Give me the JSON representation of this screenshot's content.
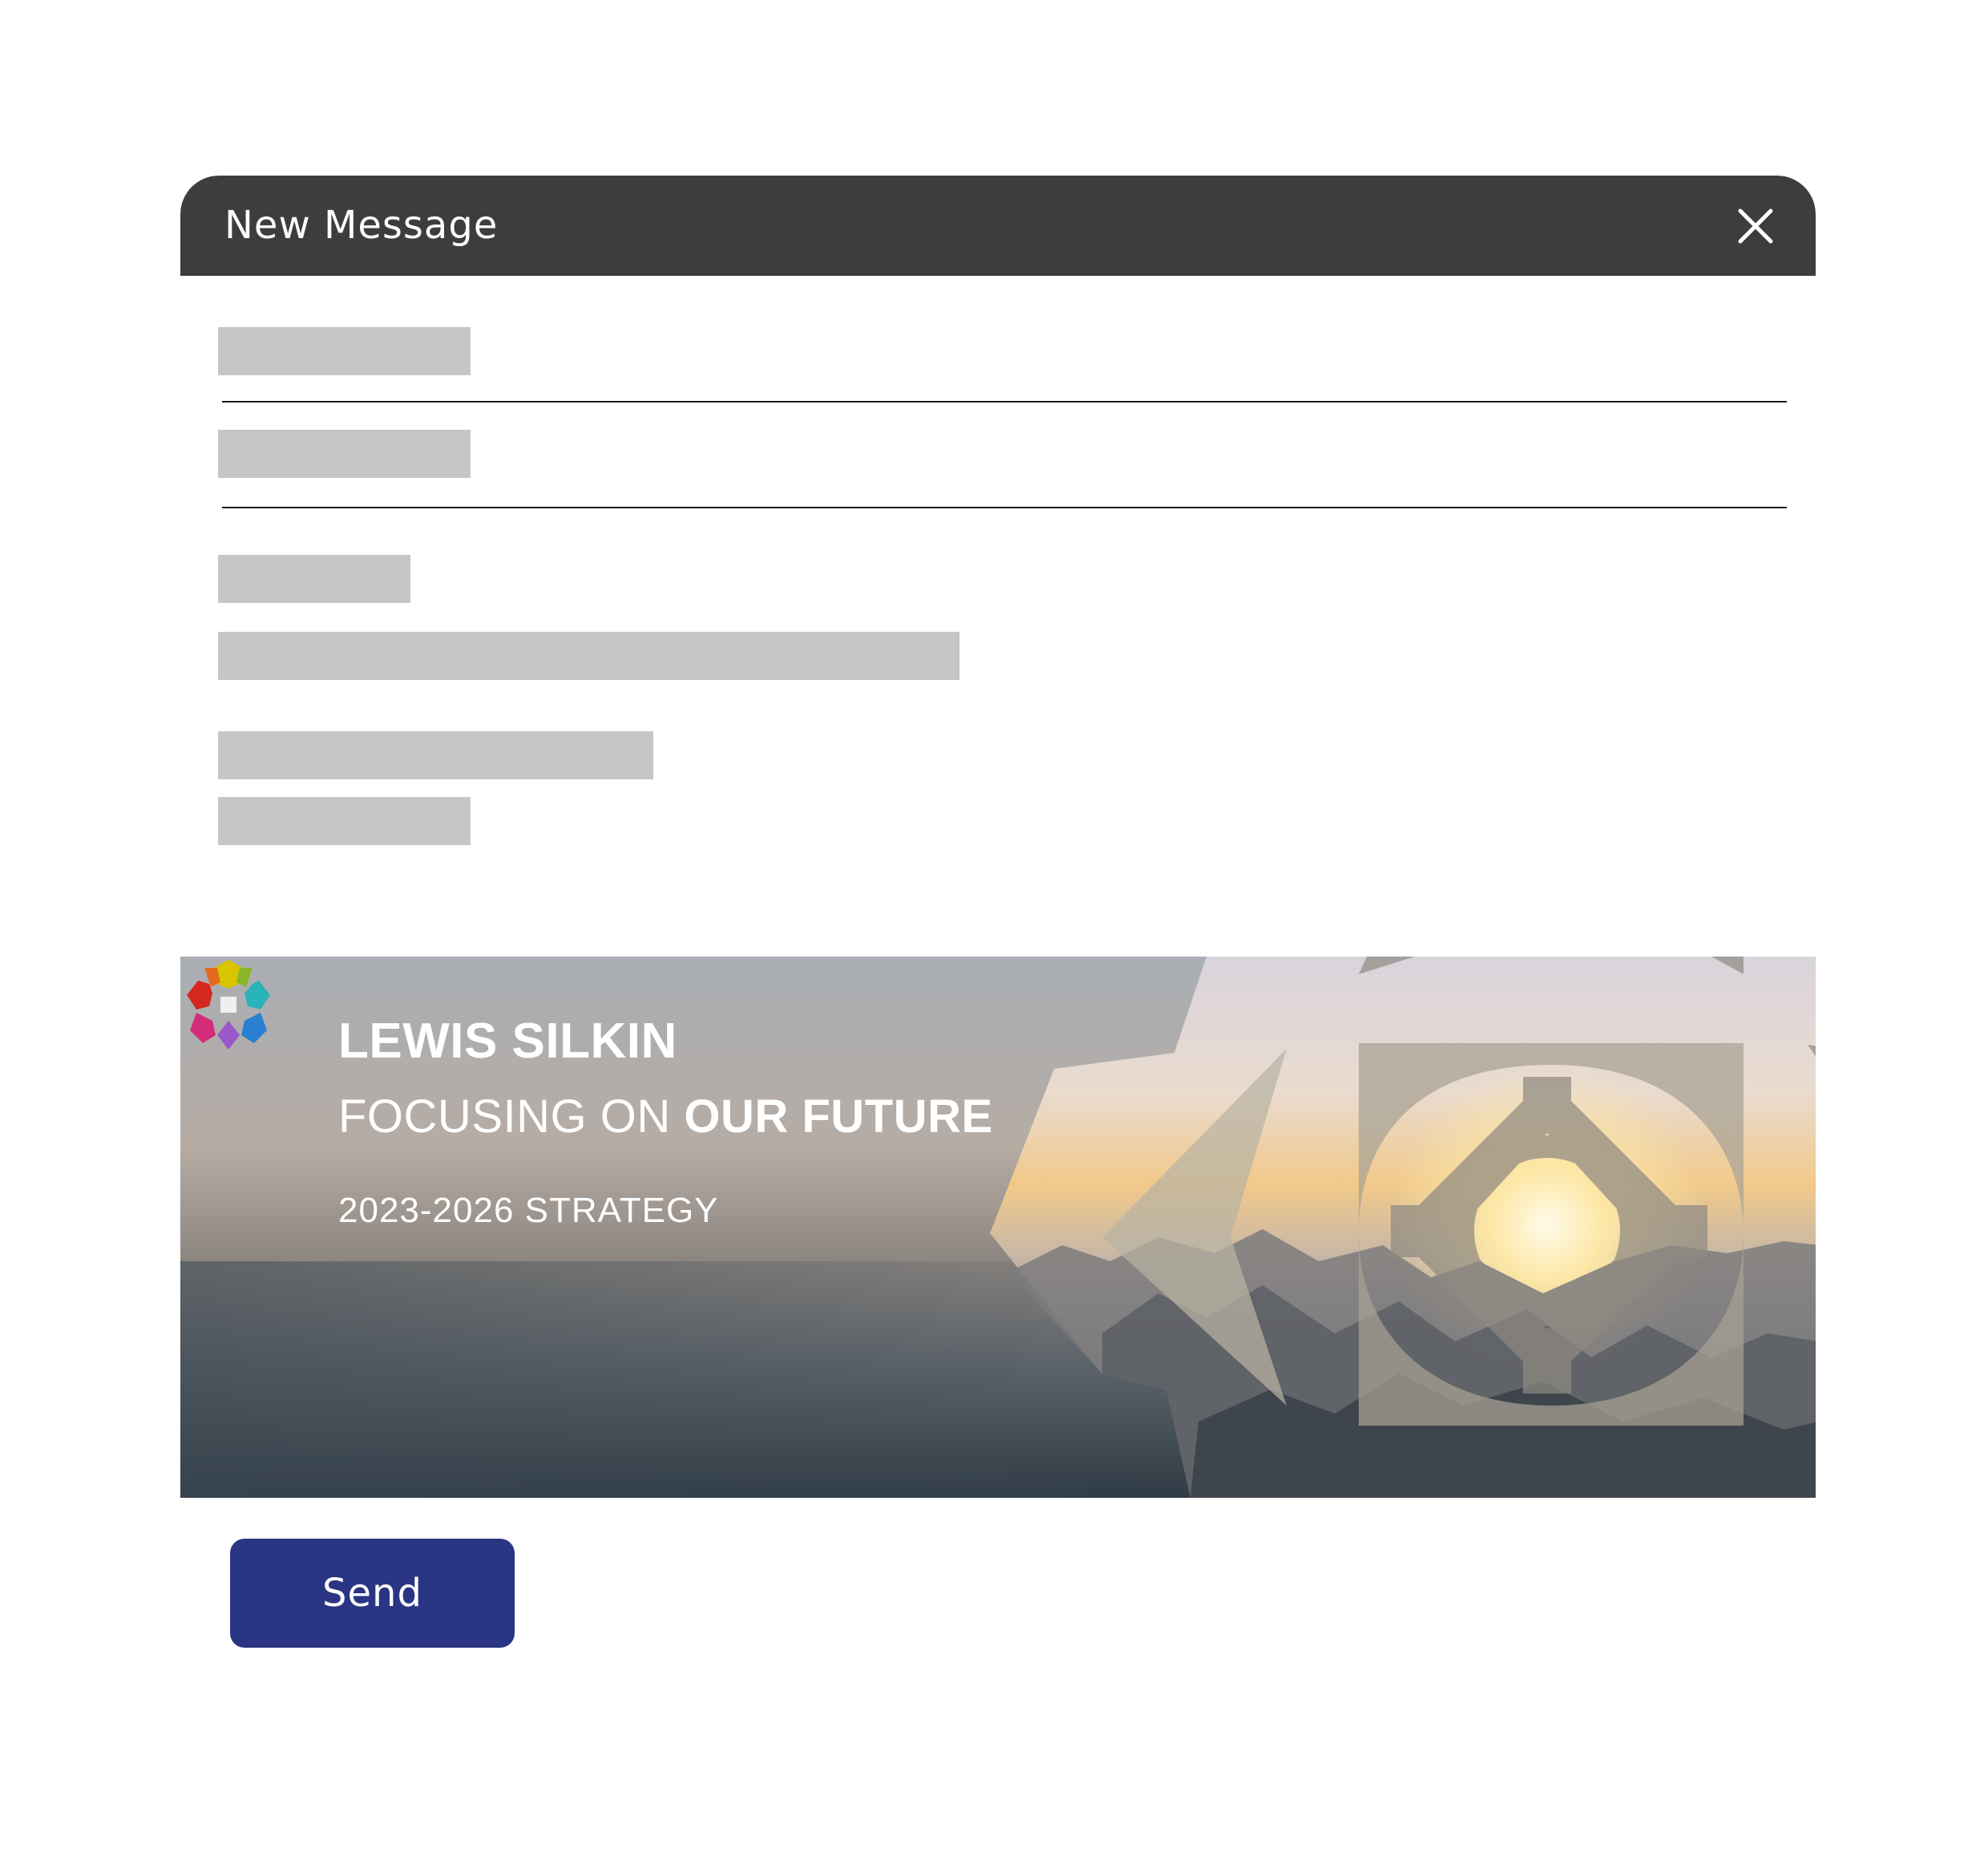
{
  "window": {
    "title": "New Message"
  },
  "icons": {
    "close": "close-x-icon",
    "logo": "lewis-silkin-flower-logo"
  },
  "banner": {
    "brand": "LEWIS SILKIN",
    "tagline_light": "FOCUSING ON ",
    "tagline_bold": "OUR FUTURE",
    "strategy": "2023-2026 STRATEGY"
  },
  "actions": {
    "send_label": "Send"
  },
  "colors": {
    "titlebar": "#3d3d3c",
    "send_button": "#2a3683",
    "placeholder": "#c6c6c6",
    "divider": "#1a1a1a"
  }
}
